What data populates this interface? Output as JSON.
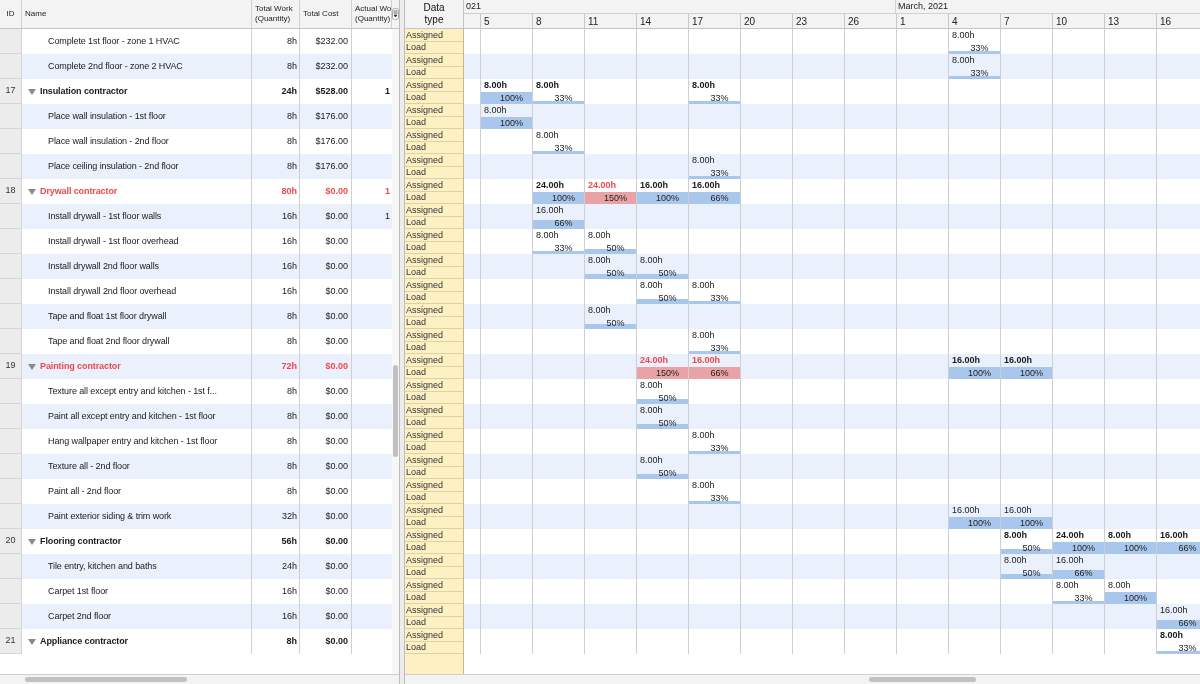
{
  "table": {
    "columns": [
      {
        "lines": [
          "ID"
        ]
      },
      {
        "lines": [
          "Name"
        ]
      },
      {
        "lines": [
          "Total Work",
          "(Quantity)"
        ]
      },
      {
        "lines": [
          "Total Cost"
        ]
      },
      {
        "lines": [
          "Actual Wo",
          "(Quantity)"
        ]
      }
    ],
    "data_type_header": "Data type",
    "months": [
      {
        "label": "021",
        "days": [
          "5",
          "8",
          "11",
          "14",
          "17",
          "20",
          "23",
          "26"
        ]
      },
      {
        "label": "March, 2021",
        "days": [
          "1",
          "4",
          "7",
          "10",
          "13",
          "16"
        ]
      }
    ],
    "rows": [
      {
        "kind": "task",
        "name": "Complete 1st floor - zone 1 HVAC",
        "total_work": "8h",
        "total_cost": "$232.00",
        "data_types": [
          "Assigned",
          "Load"
        ],
        "cells": [
          {},
          {},
          {},
          {},
          {},
          {},
          {},
          {},
          {},
          {
            "assigned": "8.00h",
            "load": "33%",
            "kind": "thin",
            "overallocated": false
          },
          {},
          {},
          {},
          {}
        ]
      },
      {
        "kind": "task",
        "name": "Complete 2nd floor - zone 2 HVAC",
        "total_work": "8h",
        "total_cost": "$232.00",
        "data_types": [
          "Assigned",
          "Load"
        ],
        "cells": [
          {},
          {},
          {},
          {},
          {},
          {},
          {},
          {},
          {},
          {
            "assigned": "8.00h",
            "load": "33%",
            "kind": "thin",
            "overallocated": false
          },
          {},
          {},
          {},
          {}
        ]
      },
      {
        "kind": "group",
        "id": "17",
        "expanded": true,
        "overallocated": false,
        "name": "Insulation contractor",
        "total_work": "24h",
        "total_cost": "$528.00",
        "actual_work": "1",
        "data_types": [
          "Assigned",
          "Load"
        ],
        "cells": [
          {
            "assigned": "8.00h",
            "load": "100%",
            "kind": "full",
            "overallocated": false
          },
          {
            "assigned": "8.00h",
            "load": "33%",
            "kind": "thin",
            "overallocated": false
          },
          {},
          {},
          {
            "assigned": "8.00h",
            "load": "33%",
            "kind": "thin",
            "overallocated": false
          },
          {},
          {},
          {},
          {},
          {},
          {},
          {},
          {},
          {}
        ]
      },
      {
        "kind": "task",
        "name": "Place wall insulation - 1st floor",
        "total_work": "8h",
        "total_cost": "$176.00",
        "data_types": [
          "Assigned",
          "Load"
        ],
        "cells": [
          {
            "assigned": "8.00h",
            "load": "100%",
            "kind": "full",
            "overallocated": false
          },
          {},
          {},
          {},
          {},
          {},
          {},
          {},
          {},
          {},
          {},
          {},
          {},
          {}
        ]
      },
      {
        "kind": "task",
        "name": "Place wall insulation - 2nd floor",
        "total_work": "8h",
        "total_cost": "$176.00",
        "data_types": [
          "Assigned",
          "Load"
        ],
        "cells": [
          {},
          {
            "assigned": "8.00h",
            "load": "33%",
            "kind": "thin",
            "overallocated": false
          },
          {},
          {},
          {},
          {},
          {},
          {},
          {},
          {},
          {},
          {},
          {},
          {}
        ]
      },
      {
        "kind": "task",
        "name": "Place ceiling insulation - 2nd floor",
        "total_work": "8h",
        "total_cost": "$176.00",
        "data_types": [
          "Assigned",
          "Load"
        ],
        "cells": [
          {},
          {},
          {},
          {},
          {
            "assigned": "8.00h",
            "load": "33%",
            "kind": "thin",
            "overallocated": false
          },
          {},
          {},
          {},
          {},
          {},
          {},
          {},
          {},
          {}
        ]
      },
      {
        "kind": "group",
        "id": "18",
        "expanded": true,
        "overallocated": true,
        "name": "Drywall contractor",
        "total_work": "80h",
        "total_cost": "$0.00",
        "actual_work": "1",
        "data_types": [
          "Assigned",
          "Load"
        ],
        "cells": [
          {},
          {
            "assigned": "24.00h",
            "load": "100%",
            "kind": "full",
            "overallocated": false
          },
          {
            "assigned": "24.00h",
            "load": "150%",
            "kind": "full",
            "overallocated": true
          },
          {
            "assigned": "16.00h",
            "load": "100%",
            "kind": "full",
            "overallocated": false
          },
          {
            "assigned": "16.00h",
            "load": "66%",
            "kind": "full",
            "overallocated": false
          },
          {},
          {},
          {},
          {},
          {},
          {},
          {},
          {},
          {}
        ]
      },
      {
        "kind": "task",
        "name": "Install drywall - 1st floor walls",
        "total_work": "16h",
        "total_cost": "$0.00",
        "actual_work": "1",
        "data_types": [
          "Assigned",
          "Load"
        ],
        "cells": [
          {},
          {
            "assigned": "16.00h",
            "load": "66%",
            "kind": "thick",
            "overallocated": false
          },
          {},
          {},
          {},
          {},
          {},
          {},
          {},
          {},
          {},
          {},
          {},
          {}
        ]
      },
      {
        "kind": "task",
        "name": "Install drywall - 1st floor overhead",
        "total_work": "16h",
        "total_cost": "$0.00",
        "data_types": [
          "Assigned",
          "Load"
        ],
        "cells": [
          {},
          {
            "assigned": "8.00h",
            "load": "33%",
            "kind": "thin",
            "overallocated": false
          },
          {
            "assigned": "8.00h",
            "load": "50%",
            "kind": "medium",
            "overallocated": false
          },
          {},
          {},
          {},
          {},
          {},
          {},
          {},
          {},
          {},
          {},
          {}
        ]
      },
      {
        "kind": "task",
        "name": "Install drywall 2nd floor walls",
        "total_work": "16h",
        "total_cost": "$0.00",
        "data_types": [
          "Assigned",
          "Load"
        ],
        "cells": [
          {},
          {},
          {
            "assigned": "8.00h",
            "load": "50%",
            "kind": "medium",
            "overallocated": false
          },
          {
            "assigned": "8.00h",
            "load": "50%",
            "kind": "medium",
            "overallocated": false
          },
          {},
          {},
          {},
          {},
          {},
          {},
          {},
          {},
          {},
          {}
        ]
      },
      {
        "kind": "task",
        "name": "Install drywall 2nd floor overhead",
        "total_work": "16h",
        "total_cost": "$0.00",
        "data_types": [
          "Assigned",
          "Load"
        ],
        "cells": [
          {},
          {},
          {},
          {
            "assigned": "8.00h",
            "load": "50%",
            "kind": "medium",
            "overallocated": false
          },
          {
            "assigned": "8.00h",
            "load": "33%",
            "kind": "thin",
            "overallocated": false
          },
          {},
          {},
          {},
          {},
          {},
          {},
          {},
          {},
          {}
        ]
      },
      {
        "kind": "task",
        "name": "Tape and float 1st floor drywall",
        "total_work": "8h",
        "total_cost": "$0.00",
        "data_types": [
          "Assigned",
          "Load"
        ],
        "cells": [
          {},
          {},
          {
            "assigned": "8.00h",
            "load": "50%",
            "kind": "medium",
            "overallocated": false
          },
          {},
          {},
          {},
          {},
          {},
          {},
          {},
          {},
          {},
          {},
          {}
        ]
      },
      {
        "kind": "task",
        "name": "Tape and float 2nd floor drywall",
        "total_work": "8h",
        "total_cost": "$0.00",
        "data_types": [
          "Assigned",
          "Load"
        ],
        "cells": [
          {},
          {},
          {},
          {},
          {
            "assigned": "8.00h",
            "load": "33%",
            "kind": "thin",
            "overallocated": false
          },
          {},
          {},
          {},
          {},
          {},
          {},
          {},
          {},
          {}
        ]
      },
      {
        "kind": "group",
        "id": "19",
        "expanded": true,
        "overallocated": true,
        "name": "Painting contractor",
        "total_work": "72h",
        "total_cost": "$0.00",
        "data_types": [
          "Assigned",
          "Load"
        ],
        "cells": [
          {},
          {},
          {},
          {
            "assigned": "24.00h",
            "load": "150%",
            "kind": "full",
            "overallocated": true
          },
          {
            "assigned": "16.00h",
            "load": "66%",
            "kind": "full",
            "overallocated": true
          },
          {},
          {},
          {},
          {},
          {
            "assigned": "16.00h",
            "load": "100%",
            "kind": "full",
            "overallocated": false
          },
          {
            "assigned": "16.00h",
            "load": "100%",
            "kind": "full",
            "overallocated": false
          },
          {},
          {},
          {}
        ]
      },
      {
        "kind": "task",
        "name": "Texture all except entry and kitchen - 1st f...",
        "total_work": "8h",
        "total_cost": "$0.00",
        "data_types": [
          "Assigned",
          "Load"
        ],
        "cells": [
          {},
          {},
          {},
          {
            "assigned": "8.00h",
            "load": "50%",
            "kind": "medium",
            "overallocated": false
          },
          {},
          {},
          {},
          {},
          {},
          {},
          {},
          {},
          {},
          {}
        ]
      },
      {
        "kind": "task",
        "name": "Paint all except entry and kitchen - 1st floor",
        "total_work": "8h",
        "total_cost": "$0.00",
        "data_types": [
          "Assigned",
          "Load"
        ],
        "cells": [
          {},
          {},
          {},
          {
            "assigned": "8.00h",
            "load": "50%",
            "kind": "medium",
            "overallocated": false
          },
          {},
          {},
          {},
          {},
          {},
          {},
          {},
          {},
          {},
          {}
        ]
      },
      {
        "kind": "task",
        "name": "Hang wallpaper entry and kitchen - 1st floor",
        "total_work": "8h",
        "total_cost": "$0.00",
        "data_types": [
          "Assigned",
          "Load"
        ],
        "cells": [
          {},
          {},
          {},
          {},
          {
            "assigned": "8.00h",
            "load": "33%",
            "kind": "thin",
            "overallocated": false
          },
          {},
          {},
          {},
          {},
          {},
          {},
          {},
          {},
          {}
        ]
      },
      {
        "kind": "task",
        "name": "Texture all - 2nd floor",
        "total_work": "8h",
        "total_cost": "$0.00",
        "data_types": [
          "Assigned",
          "Load"
        ],
        "cells": [
          {},
          {},
          {},
          {
            "assigned": "8.00h",
            "load": "50%",
            "kind": "medium",
            "overallocated": false
          },
          {},
          {},
          {},
          {},
          {},
          {},
          {},
          {},
          {},
          {}
        ]
      },
      {
        "kind": "task",
        "name": "Paint all - 2nd floor",
        "total_work": "8h",
        "total_cost": "$0.00",
        "data_types": [
          "Assigned",
          "Load"
        ],
        "cells": [
          {},
          {},
          {},
          {},
          {
            "assigned": "8.00h",
            "load": "33%",
            "kind": "thin",
            "overallocated": false
          },
          {},
          {},
          {},
          {},
          {},
          {},
          {},
          {},
          {}
        ]
      },
      {
        "kind": "task",
        "name": "Paint exterior siding & trim work",
        "total_work": "32h",
        "total_cost": "$0.00",
        "data_types": [
          "Assigned",
          "Load"
        ],
        "cells": [
          {},
          {},
          {},
          {},
          {},
          {},
          {},
          {},
          {},
          {
            "assigned": "16.00h",
            "load": "100%",
            "kind": "full",
            "overallocated": false
          },
          {
            "assigned": "16.00h",
            "load": "100%",
            "kind": "full",
            "overallocated": false
          },
          {},
          {},
          {}
        ]
      },
      {
        "kind": "group",
        "id": "20",
        "expanded": true,
        "overallocated": false,
        "name": "Flooring contractor",
        "total_work": "56h",
        "total_cost": "$0.00",
        "data_types": [
          "Assigned",
          "Load"
        ],
        "cells": [
          {},
          {},
          {},
          {},
          {},
          {},
          {},
          {},
          {},
          {},
          {
            "assigned": "8.00h",
            "load": "50%",
            "kind": "medium",
            "overallocated": false
          },
          {
            "assigned": "24.00h",
            "load": "100%",
            "kind": "full",
            "overallocated": false
          },
          {
            "assigned": "8.00h",
            "load": "100%",
            "kind": "full",
            "overallocated": false
          },
          {
            "assigned": "16.00h",
            "load": "66%",
            "kind": "full",
            "overallocated": false
          }
        ]
      },
      {
        "kind": "task",
        "name": "Tile entry, kitchen and baths",
        "total_work": "24h",
        "total_cost": "$0.00",
        "data_types": [
          "Assigned",
          "Load"
        ],
        "cells": [
          {},
          {},
          {},
          {},
          {},
          {},
          {},
          {},
          {},
          {},
          {
            "assigned": "8.00h",
            "load": "50%",
            "kind": "medium",
            "overallocated": false
          },
          {
            "assigned": "16.00h",
            "load": "66%",
            "kind": "thick",
            "overallocated": false
          },
          {},
          {}
        ]
      },
      {
        "kind": "task",
        "name": "Carpet 1st floor",
        "total_work": "16h",
        "total_cost": "$0.00",
        "data_types": [
          "Assigned",
          "Load"
        ],
        "cells": [
          {},
          {},
          {},
          {},
          {},
          {},
          {},
          {},
          {},
          {},
          {},
          {
            "assigned": "8.00h",
            "load": "33%",
            "kind": "thin",
            "overallocated": false
          },
          {
            "assigned": "8.00h",
            "load": "100%",
            "kind": "full",
            "overallocated": false
          },
          {}
        ]
      },
      {
        "kind": "task",
        "name": "Carpet 2nd floor",
        "total_work": "16h",
        "total_cost": "$0.00",
        "data_types": [
          "Assigned",
          "Load"
        ],
        "cells": [
          {},
          {},
          {},
          {},
          {},
          {},
          {},
          {},
          {},
          {},
          {},
          {},
          {},
          {
            "assigned": "16.00h",
            "load": "66%",
            "kind": "thick",
            "overallocated": false
          }
        ]
      },
      {
        "kind": "group",
        "id": "21",
        "expanded": true,
        "overallocated": false,
        "name": "Appliance contractor",
        "total_work": "8h",
        "total_cost": "$0.00",
        "data_types": [
          "Assigned",
          "Load"
        ],
        "cells": [
          {},
          {},
          {},
          {},
          {},
          {},
          {},
          {},
          {},
          {},
          {},
          {},
          {},
          {
            "assigned": "8.00h",
            "load": "33%",
            "kind": "thin",
            "overallocated": false
          }
        ]
      }
    ]
  }
}
